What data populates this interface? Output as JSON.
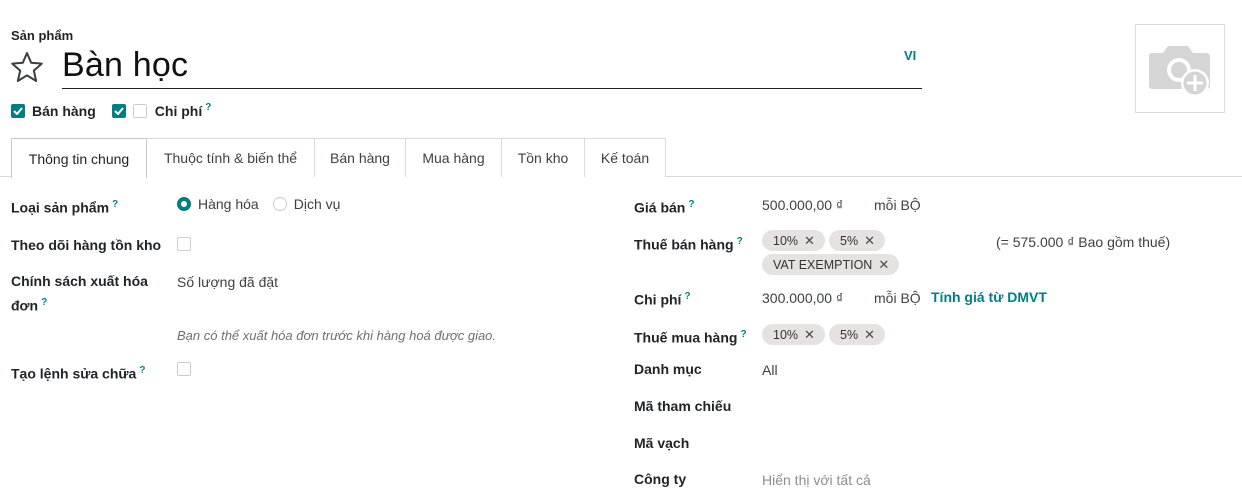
{
  "header": {
    "product_label": "Sản phẩm",
    "product_name": "Bàn học",
    "lang": "VI"
  },
  "icons": {
    "favorite": "star-outline-icon",
    "photo": "camera-plus-icon",
    "check": "checkmark-icon",
    "remove": "x-icon"
  },
  "flags": {
    "sale_label": "Bán hàng",
    "sale_checked": true,
    "expense_label": "Chi phí",
    "expense_checked_left": true,
    "expense_checked_right": false,
    "help": "?"
  },
  "tabs": [
    {
      "label": "Thông tin chung",
      "active": true
    },
    {
      "label": "Thuộc tính & biến thể",
      "active": false
    },
    {
      "label": "Bán hàng",
      "active": false
    },
    {
      "label": "Mua hàng",
      "active": false
    },
    {
      "label": "Tồn kho",
      "active": false
    },
    {
      "label": "Kế toán",
      "active": false
    }
  ],
  "left": {
    "product_type_label": "Loại sản phẩm",
    "product_type_options": [
      "Hàng hóa",
      "Dịch vụ"
    ],
    "product_type_selected": "Hàng hóa",
    "track_inventory_label": "Theo dõi hàng tồn kho",
    "track_inventory_checked": false,
    "invoice_policy_label_1": "Chính sách xuất hóa",
    "invoice_policy_label_2": "đơn",
    "invoice_policy_value": "Số lượng đã đặt",
    "invoice_policy_note": "Bạn có thể xuất hóa đơn trước khi hàng hoá được giao.",
    "repair_label": "Tạo lệnh sửa chữa",
    "repair_checked": false
  },
  "right": {
    "sale_price_label": "Giá bán",
    "sale_price_value": "500.000,00 ₫",
    "sale_price_unit": "mỗi BỘ",
    "sale_tax_label": "Thuế bán hàng",
    "sale_taxes": [
      "10%",
      "5%",
      "VAT EXEMPTION"
    ],
    "sale_tax_included": "(= 575.000 ₫ Bao gồm thuế)",
    "cost_label": "Chi phí",
    "cost_value": "300.000,00 ₫",
    "cost_unit": "mỗi BỘ",
    "cost_link": "Tính giá từ DMVT",
    "purchase_tax_label": "Thuế mua hàng",
    "purchase_taxes": [
      "10%",
      "5%"
    ],
    "category_label": "Danh mục",
    "category_value": "All",
    "reference_label": "Mã tham chiếu",
    "barcode_label": "Mã vạch",
    "company_label": "Công ty",
    "company_placeholder": "Hiển thị với tất cả"
  },
  "colors": {
    "accent": "#017e84",
    "tag_bg": "#e7e2e2"
  }
}
